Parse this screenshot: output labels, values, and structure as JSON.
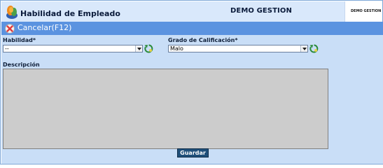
{
  "header": {
    "title": "Habilidad de Empleado",
    "company": "DEMO GESTION",
    "brand_box_text": "DEMO GESTION"
  },
  "toolbar": {
    "cancel_label": "Cancelar(F12)"
  },
  "form": {
    "skill": {
      "label": "Habilidad*",
      "value": "--"
    },
    "grade": {
      "label": "Grado de Calificación*",
      "value": "Malo"
    },
    "description": {
      "label": "Descripción",
      "value": ""
    },
    "save_label": "Guardar"
  },
  "colors": {
    "header_bg": "#d9e8fb",
    "toolbar_bg": "#5b93e0",
    "content_bg": "#c9def7",
    "button_bg": "#1f4f7a"
  }
}
